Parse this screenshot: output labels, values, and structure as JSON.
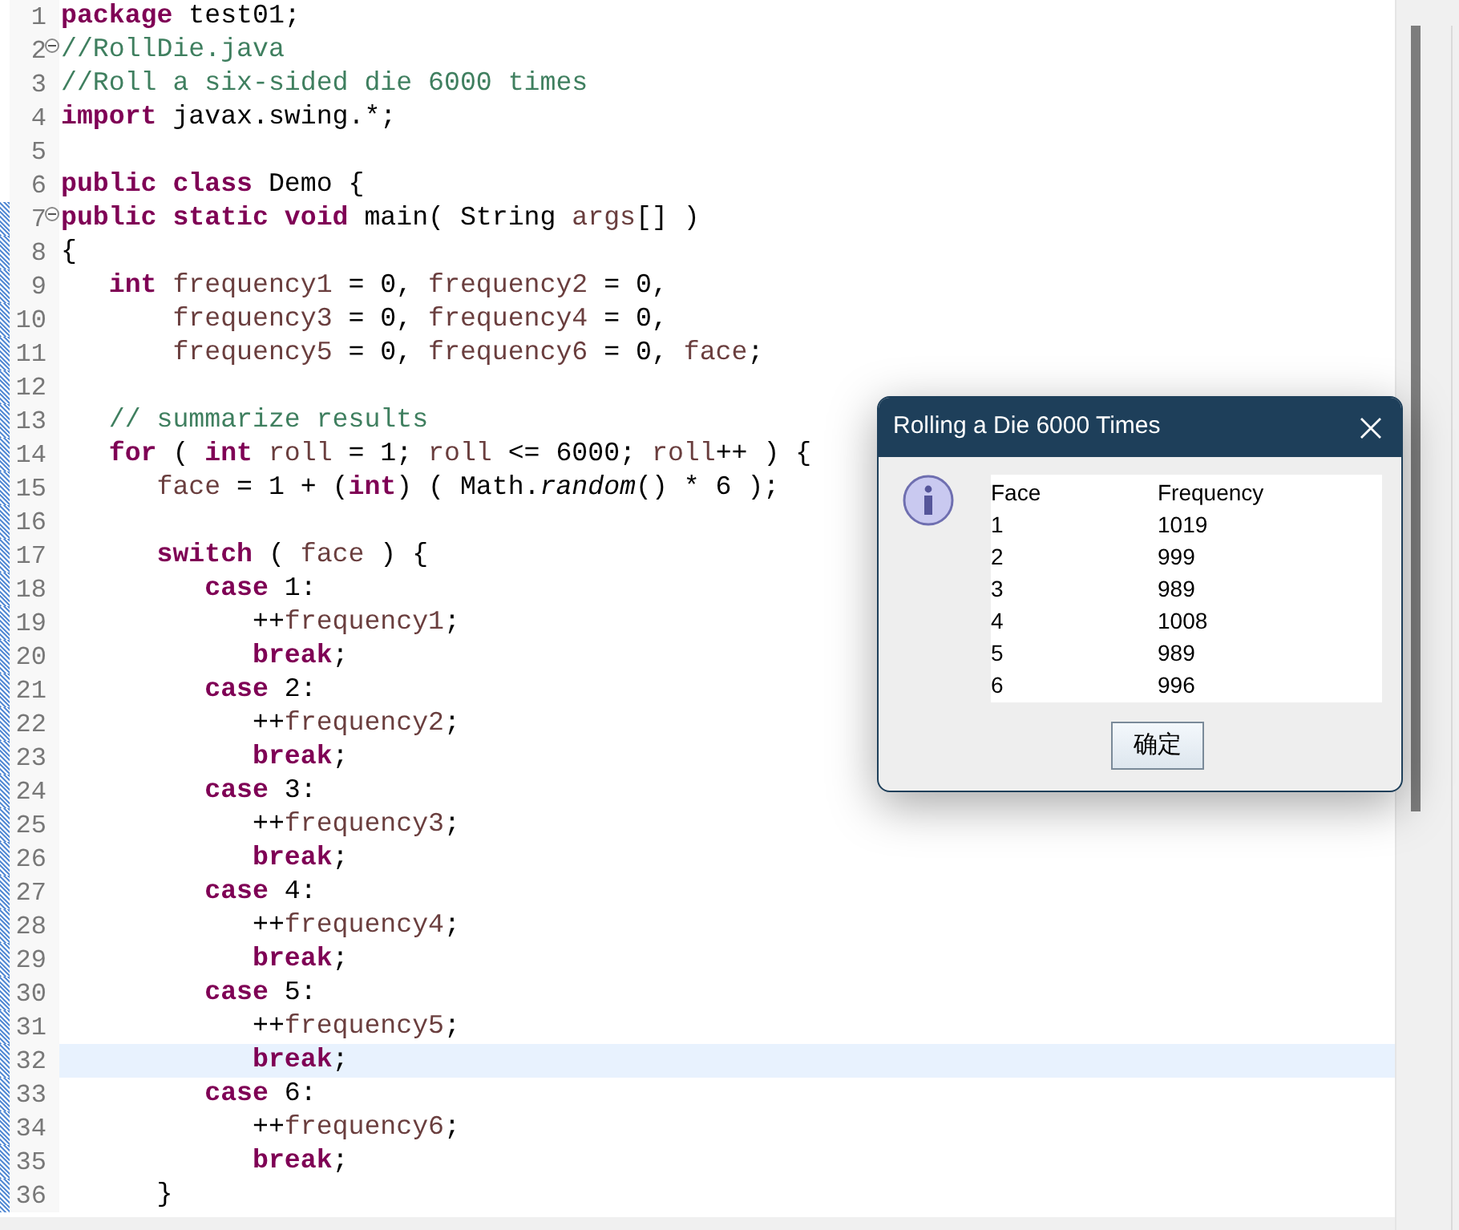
{
  "editor": {
    "lines": [
      {
        "number": "1",
        "foldable": false,
        "changed": false,
        "highlighted": false,
        "tokens": [
          {
            "kind": "kw",
            "text": "package"
          },
          {
            "kind": "pl",
            "text": " test01;"
          }
        ]
      },
      {
        "number": "2",
        "foldable": true,
        "changed": false,
        "highlighted": false,
        "tokens": [
          {
            "kind": "cm",
            "text": "//RollDie.java"
          }
        ]
      },
      {
        "number": "3",
        "foldable": false,
        "changed": false,
        "highlighted": false,
        "tokens": [
          {
            "kind": "cm",
            "text": "//Roll a six-sided die 6000 times"
          }
        ]
      },
      {
        "number": "4",
        "foldable": false,
        "changed": false,
        "highlighted": false,
        "tokens": [
          {
            "kind": "kw",
            "text": "import"
          },
          {
            "kind": "pl",
            "text": " javax.swing.*;"
          }
        ]
      },
      {
        "number": "5",
        "foldable": false,
        "changed": false,
        "highlighted": false
      },
      {
        "number": "6",
        "foldable": false,
        "changed": false,
        "highlighted": false,
        "tokens": [
          {
            "kind": "kw",
            "text": "public class"
          },
          {
            "kind": "pl",
            "text": " Demo {"
          }
        ]
      },
      {
        "number": "7",
        "foldable": true,
        "changed": true,
        "highlighted": false,
        "tokens": [
          {
            "kind": "kw",
            "text": "public static void"
          },
          {
            "kind": "pl",
            "text": " main( String "
          },
          {
            "kind": "var",
            "text": "args"
          },
          {
            "kind": "pl",
            "text": "[] )"
          }
        ]
      },
      {
        "number": "8",
        "foldable": false,
        "changed": true,
        "highlighted": false,
        "tokens": [
          {
            "kind": "pl",
            "text": "{"
          }
        ]
      },
      {
        "number": "9",
        "foldable": false,
        "changed": true,
        "highlighted": false,
        "tokens": [
          {
            "kind": "kw",
            "text": "   int"
          },
          {
            "kind": "var",
            "text": " frequency1"
          },
          {
            "kind": "pl",
            "text": " = 0, "
          },
          {
            "kind": "var",
            "text": "frequency2"
          },
          {
            "kind": "pl",
            "text": " = 0,"
          }
        ]
      },
      {
        "number": "10",
        "foldable": false,
        "changed": true,
        "highlighted": false,
        "tokens": [
          {
            "kind": "var",
            "text": "       frequency3"
          },
          {
            "kind": "pl",
            "text": " = 0, "
          },
          {
            "kind": "var",
            "text": "frequency4"
          },
          {
            "kind": "pl",
            "text": " = 0,"
          }
        ]
      },
      {
        "number": "11",
        "foldable": false,
        "changed": true,
        "highlighted": false,
        "tokens": [
          {
            "kind": "var",
            "text": "       frequency5"
          },
          {
            "kind": "pl",
            "text": " = 0, "
          },
          {
            "kind": "var",
            "text": "frequency6"
          },
          {
            "kind": "pl",
            "text": " = 0, "
          },
          {
            "kind": "var",
            "text": "face"
          },
          {
            "kind": "pl",
            "text": ";"
          }
        ]
      },
      {
        "number": "12",
        "foldable": false,
        "changed": true,
        "highlighted": false
      },
      {
        "number": "13",
        "foldable": false,
        "changed": true,
        "highlighted": false,
        "tokens": [
          {
            "kind": "cm",
            "text": "   // summarize results"
          }
        ]
      },
      {
        "number": "14",
        "foldable": false,
        "changed": true,
        "highlighted": false,
        "tokens": [
          {
            "kind": "kw",
            "text": "   for"
          },
          {
            "kind": "pl",
            "text": " ( "
          },
          {
            "kind": "kw",
            "text": "int"
          },
          {
            "kind": "var",
            "text": " roll"
          },
          {
            "kind": "pl",
            "text": " = 1; "
          },
          {
            "kind": "var",
            "text": "roll"
          },
          {
            "kind": "pl",
            "text": " <= 6000; "
          },
          {
            "kind": "var",
            "text": "roll"
          },
          {
            "kind": "pl",
            "text": "++ ) {"
          }
        ]
      },
      {
        "number": "15",
        "foldable": false,
        "changed": true,
        "highlighted": false,
        "tokens": [
          {
            "kind": "var",
            "text": "      face"
          },
          {
            "kind": "pl",
            "text": " = 1 + ("
          },
          {
            "kind": "kw",
            "text": "int"
          },
          {
            "kind": "pl",
            "text": ") ( Math."
          },
          {
            "kind": "it",
            "text": "random"
          },
          {
            "kind": "pl",
            "text": "() * 6 );"
          }
        ]
      },
      {
        "number": "16",
        "foldable": false,
        "changed": true,
        "highlighted": false
      },
      {
        "number": "17",
        "foldable": false,
        "changed": true,
        "highlighted": false,
        "tokens": [
          {
            "kind": "kw",
            "text": "      switch"
          },
          {
            "kind": "pl",
            "text": " ( "
          },
          {
            "kind": "var",
            "text": "face"
          },
          {
            "kind": "pl",
            "text": " ) {"
          }
        ]
      },
      {
        "number": "18",
        "foldable": false,
        "changed": true,
        "highlighted": false,
        "tokens": [
          {
            "kind": "kw",
            "text": "         case"
          },
          {
            "kind": "pl",
            "text": " 1:"
          }
        ]
      },
      {
        "number": "19",
        "foldable": false,
        "changed": true,
        "highlighted": false,
        "tokens": [
          {
            "kind": "pl",
            "text": "            ++"
          },
          {
            "kind": "var",
            "text": "frequency1"
          },
          {
            "kind": "pl",
            "text": ";"
          }
        ]
      },
      {
        "number": "20",
        "foldable": false,
        "changed": true,
        "highlighted": false,
        "tokens": [
          {
            "kind": "kw",
            "text": "            break"
          },
          {
            "kind": "pl",
            "text": ";"
          }
        ]
      },
      {
        "number": "21",
        "foldable": false,
        "changed": true,
        "highlighted": false,
        "tokens": [
          {
            "kind": "kw",
            "text": "         case"
          },
          {
            "kind": "pl",
            "text": " 2:"
          }
        ]
      },
      {
        "number": "22",
        "foldable": false,
        "changed": true,
        "highlighted": false,
        "tokens": [
          {
            "kind": "pl",
            "text": "            ++"
          },
          {
            "kind": "var",
            "text": "frequency2"
          },
          {
            "kind": "pl",
            "text": ";"
          }
        ]
      },
      {
        "number": "23",
        "foldable": false,
        "changed": true,
        "highlighted": false,
        "tokens": [
          {
            "kind": "kw",
            "text": "            break"
          },
          {
            "kind": "pl",
            "text": ";"
          }
        ]
      },
      {
        "number": "24",
        "foldable": false,
        "changed": true,
        "highlighted": false,
        "tokens": [
          {
            "kind": "kw",
            "text": "         case"
          },
          {
            "kind": "pl",
            "text": " 3:"
          }
        ]
      },
      {
        "number": "25",
        "foldable": false,
        "changed": true,
        "highlighted": false,
        "tokens": [
          {
            "kind": "pl",
            "text": "            ++"
          },
          {
            "kind": "var",
            "text": "frequency3"
          },
          {
            "kind": "pl",
            "text": ";"
          }
        ]
      },
      {
        "number": "26",
        "foldable": false,
        "changed": true,
        "highlighted": false,
        "tokens": [
          {
            "kind": "kw",
            "text": "            break"
          },
          {
            "kind": "pl",
            "text": ";"
          }
        ]
      },
      {
        "number": "27",
        "foldable": false,
        "changed": true,
        "highlighted": false,
        "tokens": [
          {
            "kind": "kw",
            "text": "         case"
          },
          {
            "kind": "pl",
            "text": " 4:"
          }
        ]
      },
      {
        "number": "28",
        "foldable": false,
        "changed": true,
        "highlighted": false,
        "tokens": [
          {
            "kind": "pl",
            "text": "            ++"
          },
          {
            "kind": "var",
            "text": "frequency4"
          },
          {
            "kind": "pl",
            "text": ";"
          }
        ]
      },
      {
        "number": "29",
        "foldable": false,
        "changed": true,
        "highlighted": false,
        "tokens": [
          {
            "kind": "kw",
            "text": "            break"
          },
          {
            "kind": "pl",
            "text": ";"
          }
        ]
      },
      {
        "number": "30",
        "foldable": false,
        "changed": true,
        "highlighted": false,
        "tokens": [
          {
            "kind": "kw",
            "text": "         case"
          },
          {
            "kind": "pl",
            "text": " 5:"
          }
        ]
      },
      {
        "number": "31",
        "foldable": false,
        "changed": true,
        "highlighted": false,
        "tokens": [
          {
            "kind": "pl",
            "text": "            ++"
          },
          {
            "kind": "var",
            "text": "frequency5"
          },
          {
            "kind": "pl",
            "text": ";"
          }
        ]
      },
      {
        "number": "32",
        "foldable": false,
        "changed": true,
        "highlighted": true,
        "tokens": [
          {
            "kind": "kw",
            "text": "            break"
          },
          {
            "kind": "pl",
            "text": ";"
          }
        ]
      },
      {
        "number": "33",
        "foldable": false,
        "changed": true,
        "highlighted": false,
        "tokens": [
          {
            "kind": "kw",
            "text": "         case"
          },
          {
            "kind": "pl",
            "text": " 6:"
          }
        ]
      },
      {
        "number": "34",
        "foldable": false,
        "changed": true,
        "highlighted": false,
        "tokens": [
          {
            "kind": "pl",
            "text": "            ++"
          },
          {
            "kind": "var",
            "text": "frequency6"
          },
          {
            "kind": "pl",
            "text": ";"
          }
        ]
      },
      {
        "number": "35",
        "foldable": false,
        "changed": true,
        "highlighted": false,
        "tokens": [
          {
            "kind": "kw",
            "text": "            break"
          },
          {
            "kind": "pl",
            "text": ";"
          }
        ]
      },
      {
        "number": "36",
        "foldable": false,
        "changed": true,
        "highlighted": false,
        "tokens": [
          {
            "kind": "pl",
            "text": "      }"
          }
        ]
      }
    ]
  },
  "dialog": {
    "title": "Rolling a Die 6000 Times",
    "table": {
      "columns": [
        "Face",
        "Frequency"
      ],
      "rows": [
        [
          "1",
          "1019"
        ],
        [
          "2",
          "999"
        ],
        [
          "3",
          "989"
        ],
        [
          "4",
          "1008"
        ],
        [
          "5",
          "989"
        ],
        [
          "6",
          "996"
        ]
      ]
    },
    "button": "确定"
  }
}
